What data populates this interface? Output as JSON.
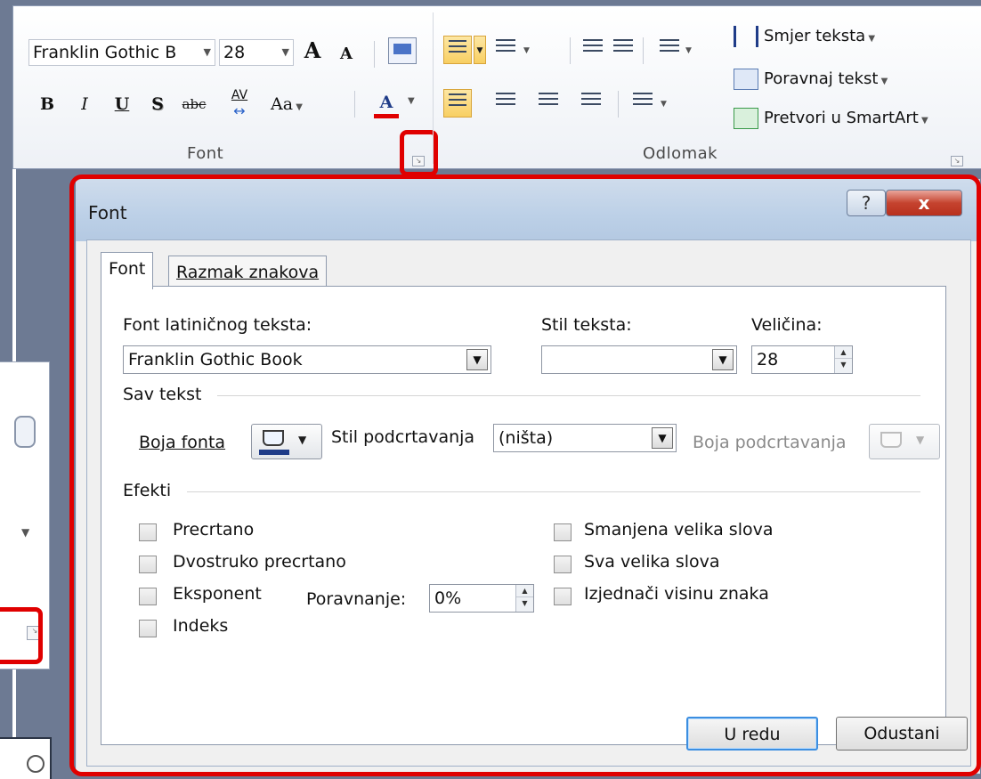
{
  "ribbon": {
    "font_group": {
      "font_name": "Franklin Gothic B",
      "font_size": "28",
      "grow_label": "A",
      "shrink_label": "A",
      "bold_label": "B",
      "italic_label": "I",
      "underline_label": "U",
      "shadow_label": "S",
      "strike_label": "abc",
      "spacing_label": "AV",
      "case_label": "Aa",
      "color_label": "A",
      "group_label": "Font"
    },
    "paragraph_group": {
      "group_label": "Odlomak",
      "text_direction": "Smjer teksta",
      "align_text": "Poravnaj tekst",
      "convert_smartart": "Pretvori u SmartArt"
    },
    "colors": {
      "highlight": "#f8cf62",
      "font_color_bar": "#e00000"
    }
  },
  "dialog": {
    "title": "Font",
    "help_label": "?",
    "close_label": "x",
    "tabs": [
      {
        "label": "Font",
        "active": true
      },
      {
        "label": "Razmak znakova",
        "active": false
      }
    ],
    "font_field": {
      "label": "Font latiničnog teksta:",
      "value": "Franklin Gothic Book"
    },
    "style_field": {
      "label": "Stil teksta:",
      "value": ""
    },
    "size_field": {
      "label": "Veličina:",
      "value": "28"
    },
    "all_text": {
      "section_label": "Sav tekst",
      "font_color_label": "Boja fonta",
      "underline_style_label": "Stil podcrtavanja",
      "underline_style_value": "(ništa)",
      "underline_color_label": "Boja podcrtavanja"
    },
    "effects": {
      "section_label": "Efekti",
      "strikethrough": "Precrtano",
      "double_strikethrough": "Dvostruko precrtano",
      "superscript": "Eksponent",
      "subscript": "Indeks",
      "small_caps": "Smanjena velika slova",
      "all_caps": "Sva velika slova",
      "equalize_height": "Izjednači visinu znaka",
      "offset_label": "Poravnanje:",
      "offset_value": "0%"
    },
    "ok_label": "U redu",
    "cancel_label": "Odustani",
    "colors": {
      "highlight_border": "#e00000",
      "font_color_swatch": "#1f3c88"
    }
  }
}
